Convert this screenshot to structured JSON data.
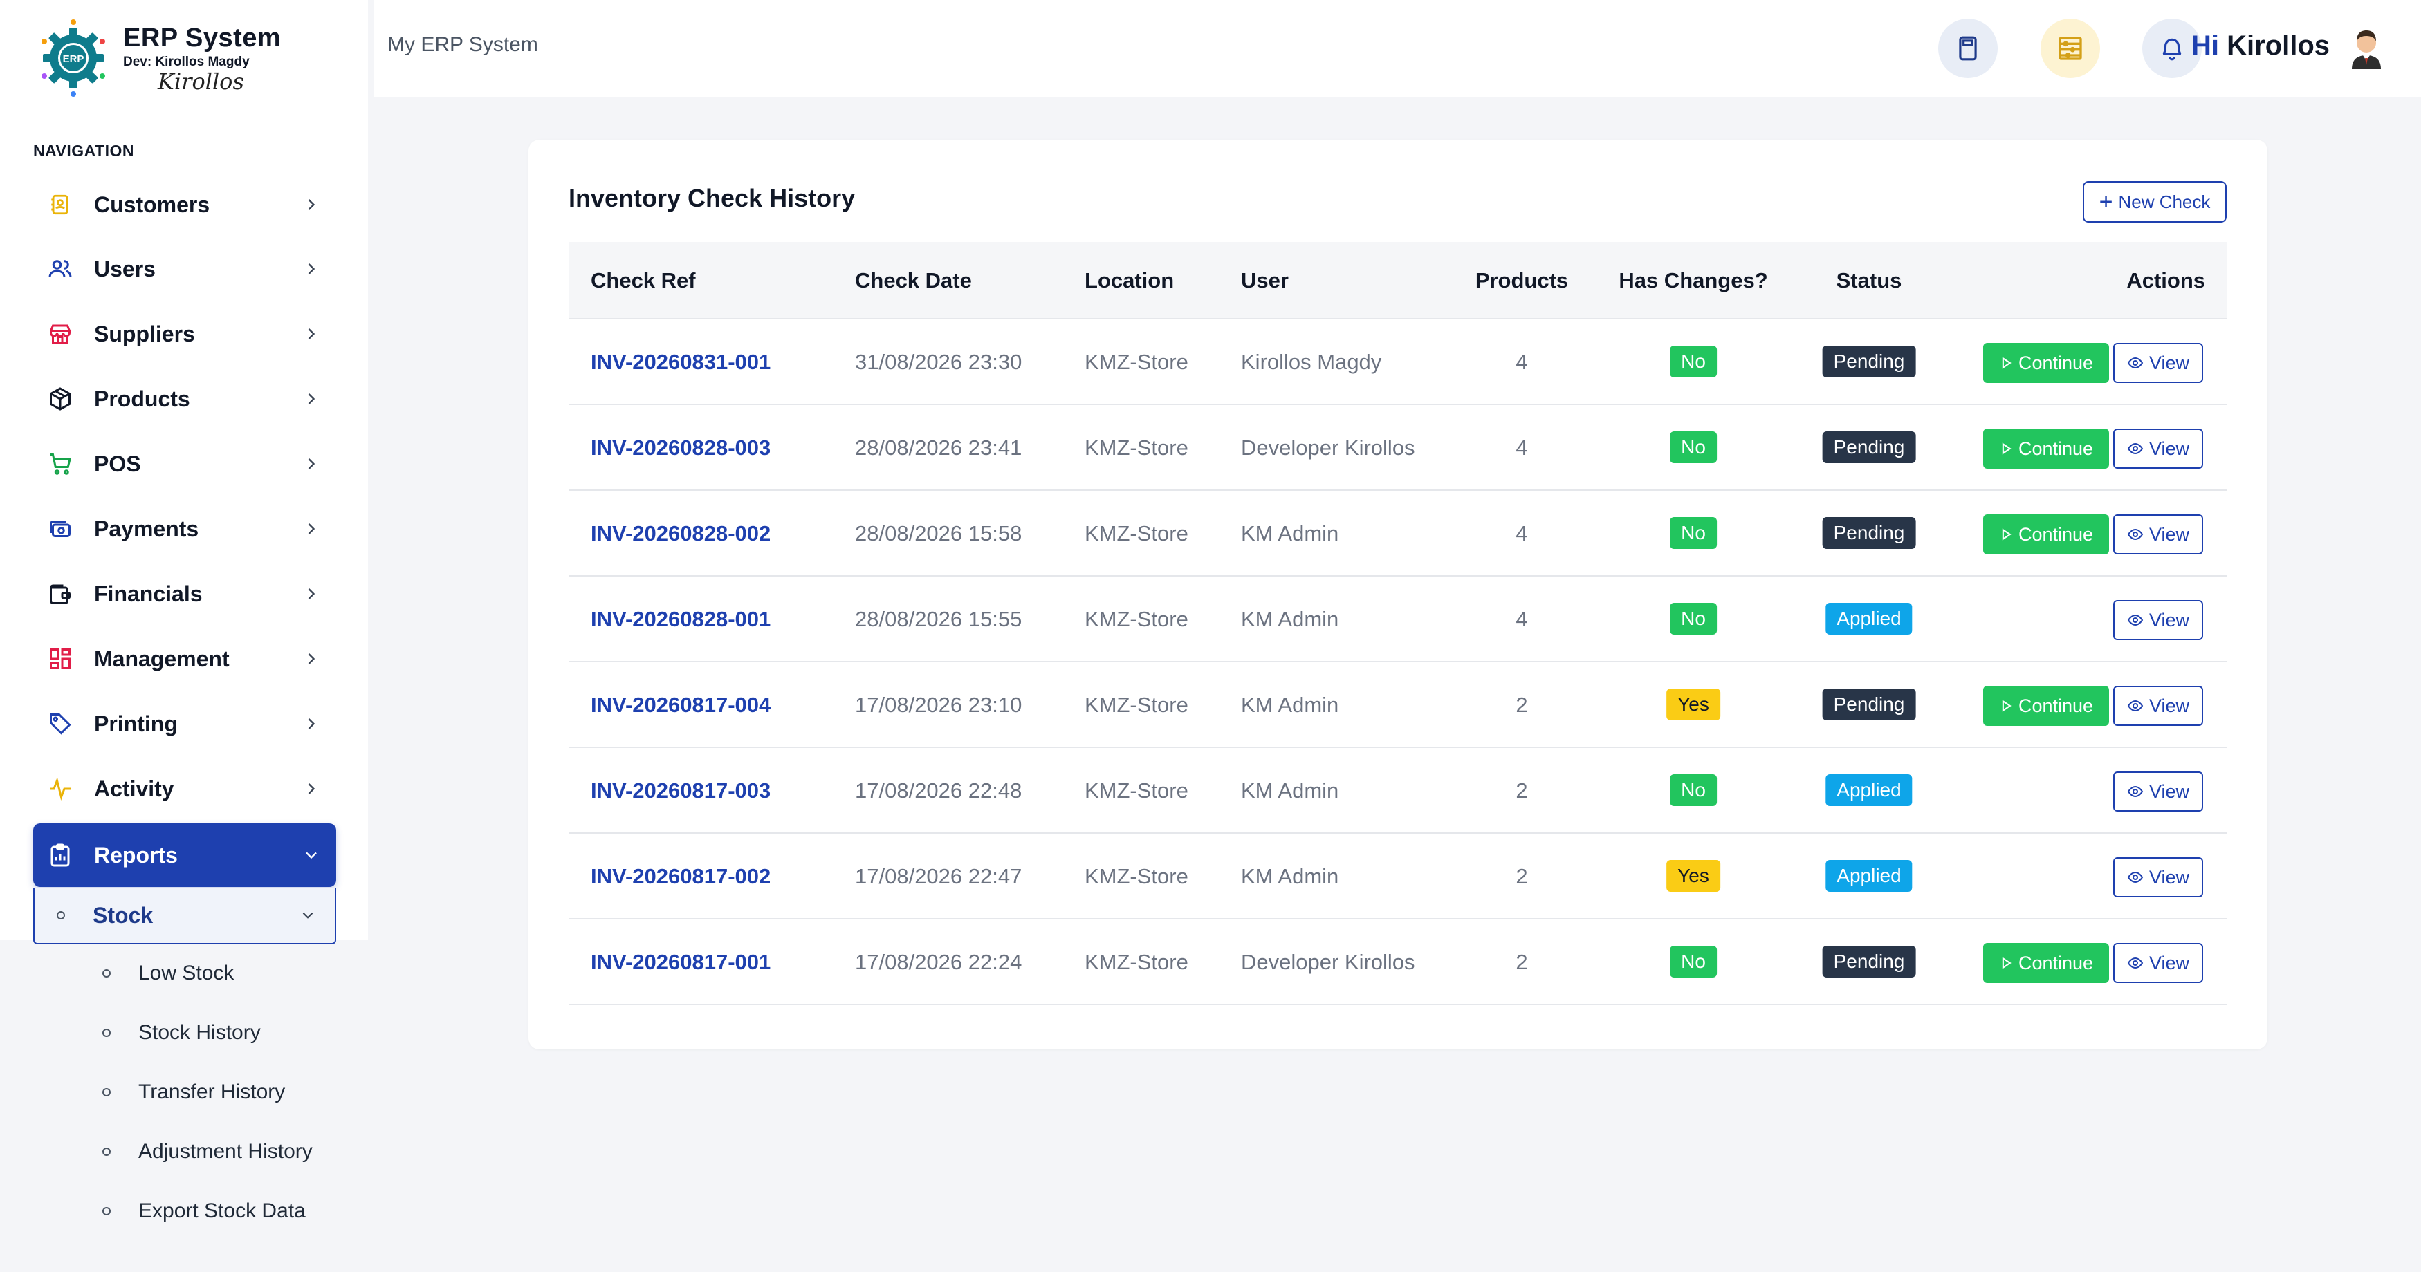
{
  "app": {
    "logo_title": "ERP System",
    "logo_dev": "Dev: Kirollos Magdy",
    "logo_signature": "Kirollos",
    "logo_badge": "ERP",
    "header_name": "My ERP System",
    "greeting_hi": "Hi",
    "greeting_name": "Kirollos"
  },
  "sidebar": {
    "heading": "NAVIGATION",
    "items": [
      {
        "label": "Customers",
        "icon": "contact-book-icon"
      },
      {
        "label": "Users",
        "icon": "users-icon"
      },
      {
        "label": "Suppliers",
        "icon": "store-icon"
      },
      {
        "label": "Products",
        "icon": "box-icon"
      },
      {
        "label": "POS",
        "icon": "cart-icon"
      },
      {
        "label": "Payments",
        "icon": "payments-icon"
      },
      {
        "label": "Financials",
        "icon": "wallet-icon"
      },
      {
        "label": "Management",
        "icon": "grid-icon"
      },
      {
        "label": "Printing",
        "icon": "tag-icon"
      },
      {
        "label": "Activity",
        "icon": "activity-icon"
      },
      {
        "label": "Reports",
        "icon": "clipboard-icon",
        "active": true
      }
    ],
    "sub_item": "Stock",
    "sub_links": [
      "Low Stock",
      "Stock History",
      "Transfer History",
      "Adjustment History",
      "Export Stock Data"
    ]
  },
  "card": {
    "title": "Inventory Check History",
    "new_button": "New Check",
    "columns": [
      "Check Ref",
      "Check Date",
      "Location",
      "User",
      "Products",
      "Has Changes?",
      "Status",
      "Actions"
    ],
    "continue_label": "Continue",
    "view_label": "View",
    "rows": [
      {
        "ref": "INV-20260831-001",
        "date": "31/08/2026 23:30",
        "location": "KMZ-Store",
        "user": "Kirollos Magdy",
        "products": "4",
        "changes": "No",
        "status": "Pending"
      },
      {
        "ref": "INV-20260828-003",
        "date": "28/08/2026 23:41",
        "location": "KMZ-Store",
        "user": "Developer Kirollos",
        "products": "4",
        "changes": "No",
        "status": "Pending"
      },
      {
        "ref": "INV-20260828-002",
        "date": "28/08/2026 15:58",
        "location": "KMZ-Store",
        "user": "KM Admin",
        "products": "4",
        "changes": "No",
        "status": "Pending"
      },
      {
        "ref": "INV-20260828-001",
        "date": "28/08/2026 15:55",
        "location": "KMZ-Store",
        "user": "KM Admin",
        "products": "4",
        "changes": "No",
        "status": "Applied"
      },
      {
        "ref": "INV-20260817-004",
        "date": "17/08/2026 23:10",
        "location": "KMZ-Store",
        "user": "KM Admin",
        "products": "2",
        "changes": "Yes",
        "status": "Pending"
      },
      {
        "ref": "INV-20260817-003",
        "date": "17/08/2026 22:48",
        "location": "KMZ-Store",
        "user": "KM Admin",
        "products": "2",
        "changes": "No",
        "status": "Applied"
      },
      {
        "ref": "INV-20260817-002",
        "date": "17/08/2026 22:47",
        "location": "KMZ-Store",
        "user": "KM Admin",
        "products": "2",
        "changes": "Yes",
        "status": "Applied"
      },
      {
        "ref": "INV-20260817-001",
        "date": "17/08/2026 22:24",
        "location": "KMZ-Store",
        "user": "Developer Kirollos",
        "products": "2",
        "changes": "No",
        "status": "Pending"
      }
    ]
  },
  "colors": {
    "primary": "#1e40af",
    "success": "#22c55e",
    "warning": "#facc15",
    "dark": "#283548",
    "info": "#0ea5e9"
  }
}
